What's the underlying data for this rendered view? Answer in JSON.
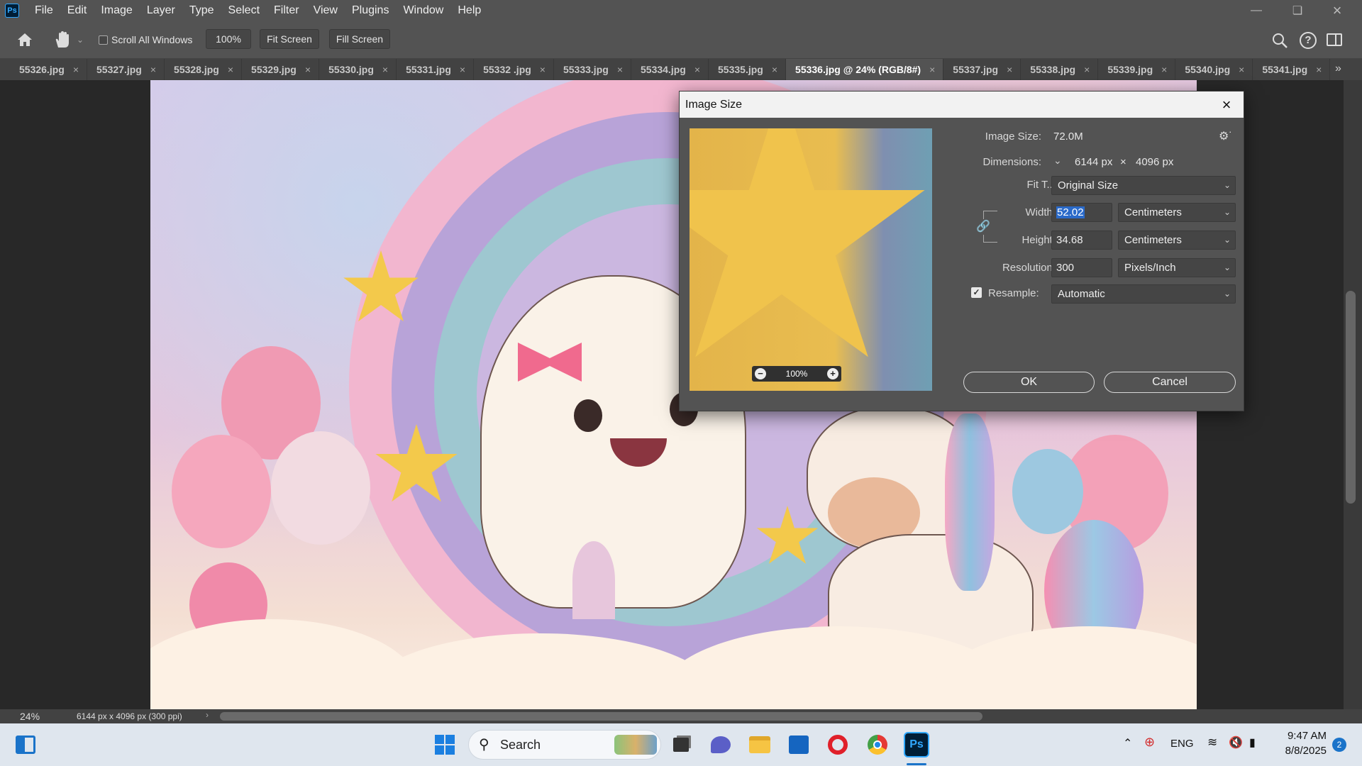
{
  "app": {
    "logo": "Ps",
    "menu": [
      "File",
      "Edit",
      "Image",
      "Layer",
      "Type",
      "Select",
      "Filter",
      "View",
      "Plugins",
      "Window",
      "Help"
    ]
  },
  "options_bar": {
    "scroll_all_windows": "Scroll All Windows",
    "zoom_value": "100%",
    "fit_screen": "Fit Screen",
    "fill_screen": "Fill Screen"
  },
  "tabs": [
    {
      "label": "55326.jpg",
      "active": false
    },
    {
      "label": "55327.jpg",
      "active": false
    },
    {
      "label": "55328.jpg",
      "active": false
    },
    {
      "label": "55329.jpg",
      "active": false
    },
    {
      "label": "55330.jpg",
      "active": false
    },
    {
      "label": "55331.jpg",
      "active": false
    },
    {
      "label": "55332 .jpg",
      "active": false
    },
    {
      "label": "55333.jpg",
      "active": false
    },
    {
      "label": "55334.jpg",
      "active": false
    },
    {
      "label": "55335.jpg",
      "active": false
    },
    {
      "label": "55336.jpg @ 24% (RGB/8#)",
      "active": true
    },
    {
      "label": "55337.jpg",
      "active": false
    },
    {
      "label": "55338.jpg",
      "active": false
    },
    {
      "label": "55339.jpg",
      "active": false
    },
    {
      "label": "55340.jpg",
      "active": false
    },
    {
      "label": "55341.jpg",
      "active": false
    }
  ],
  "status": {
    "zoom": "24%",
    "doc_info": "6144 px x 4096 px (300 ppi)"
  },
  "dialog": {
    "title": "Image Size",
    "image_size_label": "Image Size:",
    "image_size_value": "72.0M",
    "dimensions_label": "Dimensions:",
    "dim_width": "6144 px",
    "dim_times": "×",
    "dim_height": "4096 px",
    "fit_to_label": "Fit T...",
    "fit_to_value": "Original Size",
    "width_label": "Width:",
    "width_value": "52.02",
    "width_unit": "Centimeters",
    "height_label": "Height:",
    "height_value": "34.68",
    "height_unit": "Centimeters",
    "resolution_label": "Resolution:",
    "resolution_value": "300",
    "resolution_unit": "Pixels/Inch",
    "resample_label": "Resample:",
    "resample_value": "Automatic",
    "preview_zoom": "100%",
    "ok": "OK",
    "cancel": "Cancel"
  },
  "taskbar": {
    "search": "Search",
    "lang": "ENG",
    "time": "9:47 AM",
    "date": "8/8/2025",
    "notifications": "2"
  },
  "colors": {
    "ps_blue": "#31a8ff",
    "selection_blue": "#2a6ac9",
    "panel_gray": "#535353"
  }
}
